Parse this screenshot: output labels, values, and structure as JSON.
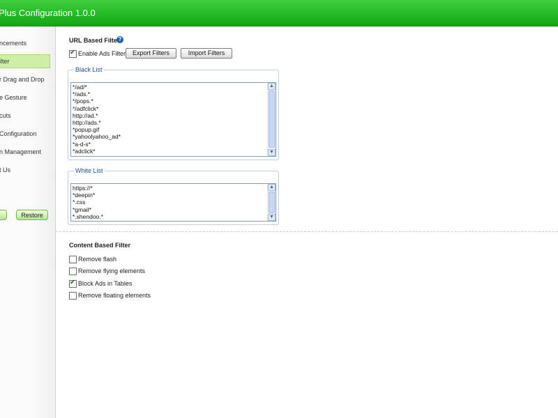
{
  "window": {
    "title": "Plus Configuration 1.0.0"
  },
  "sidebar": {
    "items": [
      {
        "label": "ncements",
        "selected": false
      },
      {
        "label": "ilter",
        "selected": true
      },
      {
        "label": "r Drag and Drop",
        "selected": false
      },
      {
        "label": "e Gesture",
        "selected": false
      },
      {
        "label": "cuts",
        "selected": false
      },
      {
        "label": "Configuration",
        "selected": false
      },
      {
        "label": "n Management",
        "selected": false
      },
      {
        "label": "t Us",
        "selected": false
      }
    ],
    "restore_label": "Restore"
  },
  "url_filter": {
    "title": "URL Based Filter",
    "help_icon": "question-icon",
    "enable_label": "Enable Ads Filter",
    "enable_checked": true,
    "export_label": "Export Filters",
    "import_label": "Import Filters"
  },
  "black_list": {
    "title": "Black List",
    "items": [
      "*/ad/*",
      "*/ads.*",
      "*/pops.*",
      "*/adfclick*",
      "http://ad.*",
      "http://ads.*",
      "*popup.gif",
      "*yahoolyahoo_ad*",
      "*a-d-s*",
      "*adclick*"
    ]
  },
  "white_list": {
    "title": "White List",
    "items": [
      "https://*",
      "*deepin*",
      "*.css",
      "*gmail*",
      "*.shendoo.*"
    ]
  },
  "content_filter": {
    "title": "Content Based Filter",
    "options": [
      {
        "label": "Remove flash",
        "checked": false
      },
      {
        "label": "Remove flying elements",
        "checked": false
      },
      {
        "label": "Block Ads in Tables",
        "checked": true
      },
      {
        "label": "Remove floating elements",
        "checked": false
      }
    ]
  },
  "colors": {
    "header_green": "#22b922",
    "selected_item": "#cdf0a4",
    "legend_blue": "#1d4f9c"
  }
}
